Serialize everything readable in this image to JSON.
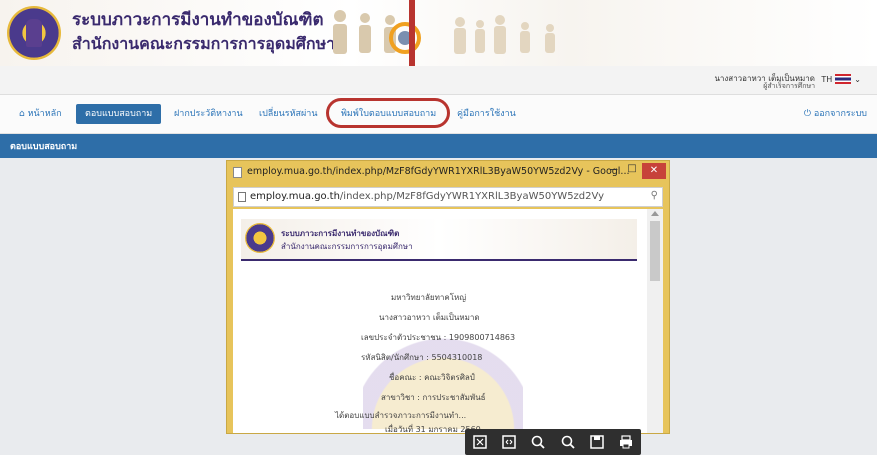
{
  "header": {
    "title": "ระบบภาวะการมีงานทำของบัณฑิต",
    "subtitle": "สำนักงานคณะกรรมการการอุดมศึกษา"
  },
  "user": {
    "name": "นางสาวอาหวา เต็มเป็นหมาด",
    "role": "ผู้สำเร็จการศึกษา",
    "language": "TH"
  },
  "nav": {
    "items": [
      {
        "label": "หน้าหลัก",
        "icon": "home-icon"
      },
      {
        "label": "ตอบแบบสอบถาม",
        "active": true
      },
      {
        "label": "ฝากประวัติหางาน"
      },
      {
        "label": "เปลี่ยนรหัสผ่าน"
      },
      {
        "label": "พิมพ์ใบตอบแบบสอบถาม",
        "highlighted": true
      },
      {
        "label": "คู่มือการใช้งาน"
      }
    ],
    "logout": "ออกจากระบบ"
  },
  "section": {
    "title": "ตอบแบบสอบถาม"
  },
  "popup": {
    "window_title": "employ.mua.go.th/index.php/MzF8fGdyYWR1YXRlL3ByaW50YW5zd2Vy - Googl...",
    "url_host": "employ.mua.go.th",
    "url_path": "/index.php/MzF8fGdyYWR1YXRlL3ByaW50YW5zd2Vy",
    "min": "−",
    "max": "□",
    "close": "✕",
    "document": {
      "banner_title": "ระบบภาวะการมีงานทำของบัณฑิต",
      "banner_subtitle": "สำนักงานคณะกรรมการการอุดมศึกษา",
      "university": "มหาวิทยาลัยทาคโหญ่",
      "name": "นางสาวอาหวา เต็มเป็นหมาด",
      "id_card": "เลขประจำตัวประชาชน : 1909800714863",
      "student_id": "รหัสนิสิต/นักศึกษา : 5504310018",
      "faculty": "ชื่อคณะ : คณะวิจิตรศิลป์",
      "program": "สาขาวิชา : การประชาสัมพันธ์",
      "completed": "ได้ตอบแบบสำรวจภาวะการมีงานทำ...",
      "date": "เมื่อวันที่ 31 มกราคม 2560"
    },
    "toolbar": [
      "fit-icon",
      "fit-width-icon",
      "zoom-out-icon",
      "zoom-in-icon",
      "save-icon",
      "print-icon"
    ]
  },
  "colors": {
    "nav_blue": "#2e6ea8",
    "highlight_red": "#b8342f",
    "popup_gold": "#e7c45b"
  }
}
